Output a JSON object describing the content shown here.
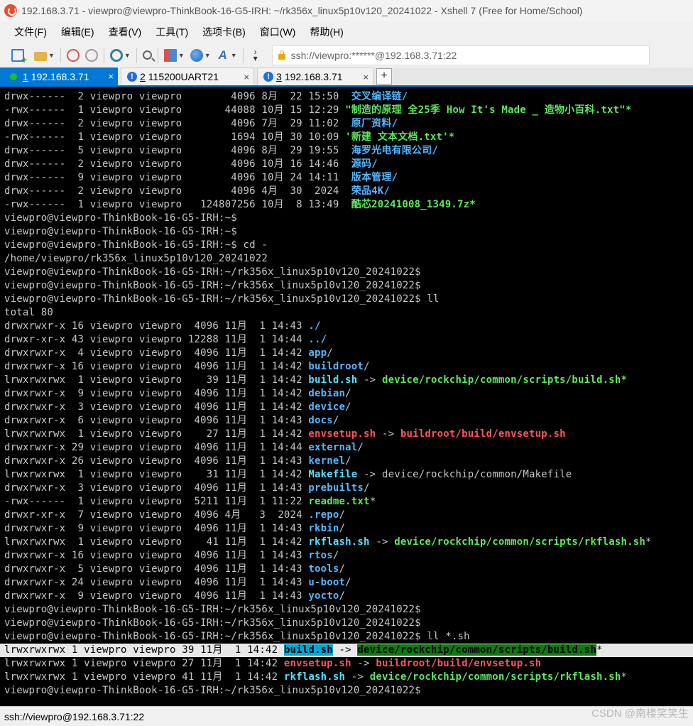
{
  "window": {
    "title": "192.168.3.71 - viewpro@viewpro-ThinkBook-16-G5-IRH: ~/rk356x_linux5p10v120_20241022 - Xshell 7 (Free for Home/School)"
  },
  "menu": [
    "文件(F)",
    "编辑(E)",
    "查看(V)",
    "工具(T)",
    "选项卡(B)",
    "窗口(W)",
    "帮助(H)"
  ],
  "toolbar": {
    "address": "ssh://viewpro:******@192.168.3.71:22"
  },
  "tabs": [
    {
      "num": "1",
      "label": "192.168.3.71",
      "close": "×"
    },
    {
      "num": "2",
      "label": "115200UART21",
      "close": "×"
    },
    {
      "num": "3",
      "label": "192.168.3.71",
      "close": "×"
    }
  ],
  "add_tab": "+",
  "terminal": {
    "l01": "drwx------  2 viewpro viewpro        4096 8月  22 15:50  ",
    "l01n": "交叉编译链",
    "l02": "-rwx------  1 viewpro viewpro       44088 10月 15 12:29 ",
    "l02n": "\"制造的原理 全25季 How It's Made _ 造物小百科.txt\"*",
    "l03": "drwx------  2 viewpro viewpro        4096 7月  29 11:02  ",
    "l03n": "原厂资料",
    "l04": "-rwx------  1 viewpro viewpro        1694 10月 30 10:09 ",
    "l04n": "'新建 文本文档.txt'*",
    "l05": "drwx------  5 viewpro viewpro        4096 8月  29 19:55  ",
    "l05n": "海罗光电有限公司",
    "l06": "drwx------  2 viewpro viewpro        4096 10月 16 14:46  ",
    "l06n": "源码",
    "l07": "drwx------  9 viewpro viewpro        4096 10月 24 14:11  ",
    "l07n": "版本管理",
    "l08": "drwx------  2 viewpro viewpro        4096 4月  30  2024  ",
    "l08n": "荣品4K",
    "l09": "-rwx------  1 viewpro viewpro   124807256 10月  8 13:49  ",
    "l09n": "酷芯20241008_1349.7z*",
    "p1": "viewpro@viewpro-ThinkBook-16-G5-IRH:~$",
    "p2": "viewpro@viewpro-ThinkBook-16-G5-IRH:~$",
    "p3": "viewpro@viewpro-ThinkBook-16-G5-IRH:~$ cd -",
    "p4": "/home/viewpro/rk356x_linux5p10v120_20241022",
    "p5": "viewpro@viewpro-ThinkBook-16-G5-IRH:~/rk356x_linux5p10v120_20241022$",
    "p6": "viewpro@viewpro-ThinkBook-16-G5-IRH:~/rk356x_linux5p10v120_20241022$",
    "p7": "viewpro@viewpro-ThinkBook-16-G5-IRH:~/rk356x_linux5p10v120_20241022$ ll",
    "total": "total 80",
    "r01": "drwxrwxr-x 16 viewpro viewpro  4096 11月  1 14:43 ",
    "r01n": "./",
    "r02": "drwxr-xr-x 43 viewpro viewpro 12288 11月  1 14:44 ",
    "r02n": "../",
    "r03": "drwxrwxr-x  4 viewpro viewpro  4096 11月  1 14:42 ",
    "r03n": "app",
    "r04": "drwxrwxr-x 16 viewpro viewpro  4096 11月  1 14:42 ",
    "r04n": "buildroot",
    "r05": "lrwxrwxrwx  1 viewpro viewpro    39 11月  1 14:42 ",
    "r05n": "build.sh",
    "r05t": "device/rockchip/common/scripts/build.sh",
    "r06": "drwxrwxr-x  9 viewpro viewpro  4096 11月  1 14:42 ",
    "r06n": "debian",
    "r07": "drwxrwxr-x  3 viewpro viewpro  4096 11月  1 14:42 ",
    "r07n": "device",
    "r08": "drwxrwxr-x  6 viewpro viewpro  4096 11月  1 14:43 ",
    "r08n": "docs",
    "r09": "lrwxrwxrwx  1 viewpro viewpro    27 11月  1 14:42 ",
    "r09n": "envsetup.sh",
    "r09t": "buildroot/build/envsetup.sh",
    "r10": "drwxrwxr-x 29 viewpro viewpro  4096 11月  1 14:44 ",
    "r10n": "external",
    "r11": "drwxrwxr-x 26 viewpro viewpro  4096 11月  1 14:43 ",
    "r11n": "kernel",
    "r12": "lrwxrwxrwx  1 viewpro viewpro    31 11月  1 14:42 ",
    "r12n": "Makefile",
    "r12t": "device/rockchip/common/Makefile",
    "r13": "drwxrwxr-x  3 viewpro viewpro  4096 11月  1 14:43 ",
    "r13n": "prebuilts",
    "r14": "-rwx------  1 viewpro viewpro  5211 11月  1 11:22 ",
    "r14n": "readme.txt",
    "r15": "drwxr-xr-x  7 viewpro viewpro  4096 4月   3  2024 ",
    "r15n": ".repo",
    "r16": "drwxrwxr-x  9 viewpro viewpro  4096 11月  1 14:43 ",
    "r16n": "rkbin",
    "r17": "lrwxrwxrwx  1 viewpro viewpro    41 11月  1 14:42 ",
    "r17n": "rkflash.sh",
    "r17t": "device/rockchip/common/scripts/rkflash.sh",
    "r18": "drwxrwxr-x 16 viewpro viewpro  4096 11月  1 14:43 ",
    "r18n": "rtos",
    "r19": "drwxrwxr-x  5 viewpro viewpro  4096 11月  1 14:43 ",
    "r19n": "tools",
    "r20": "drwxrwxr-x 24 viewpro viewpro  4096 11月  1 14:43 ",
    "r20n": "u-boot",
    "r21": "drwxrwxr-x  9 viewpro viewpro  4096 11月  1 14:43 ",
    "r21n": "yocto",
    "q1": "viewpro@viewpro-ThinkBook-16-G5-IRH:~/rk356x_linux5p10v120_20241022$",
    "q2": "viewpro@viewpro-ThinkBook-16-G5-IRH:~/rk356x_linux5p10v120_20241022$",
    "q3": "viewpro@viewpro-ThinkBook-16-G5-IRH:~/rk356x_linux5p10v120_20241022$ ll *.sh",
    "s1": "lrwxrwxrwx 1 viewpro viewpro 39 11月  1 14:42 ",
    "s1n": "build.sh",
    "s1t": "device/rockchip/common/scripts/build.sh",
    "s2": "lrwxrwxrwx 1 viewpro viewpro 27 11月  1 14:42 ",
    "s2n": "envsetup.sh",
    "s2t": "buildroot/build/envsetup.sh",
    "s3": "lrwxrwxrwx 1 viewpro viewpro 41 11月  1 14:42 ",
    "s3n": "rkflash.sh",
    "s3t": "device/rockchip/common/scripts/rkflash.sh",
    "q4": "viewpro@viewpro-ThinkBook-16-G5-IRH:~/rk356x_linux5p10v120_20241022$",
    "arrow": " -> ",
    "slash": "/",
    "star": "*"
  },
  "status": {
    "text": "ssh://viewpro@192.168.3.71:22"
  },
  "watermark": "CSDN @南楼笑笑生",
  "colors": {
    "dir": "#55b6ff",
    "exec": "#5ee75e",
    "broken": "#ff5454",
    "link": "#56e0ff",
    "tab_active": "#0078d7"
  }
}
